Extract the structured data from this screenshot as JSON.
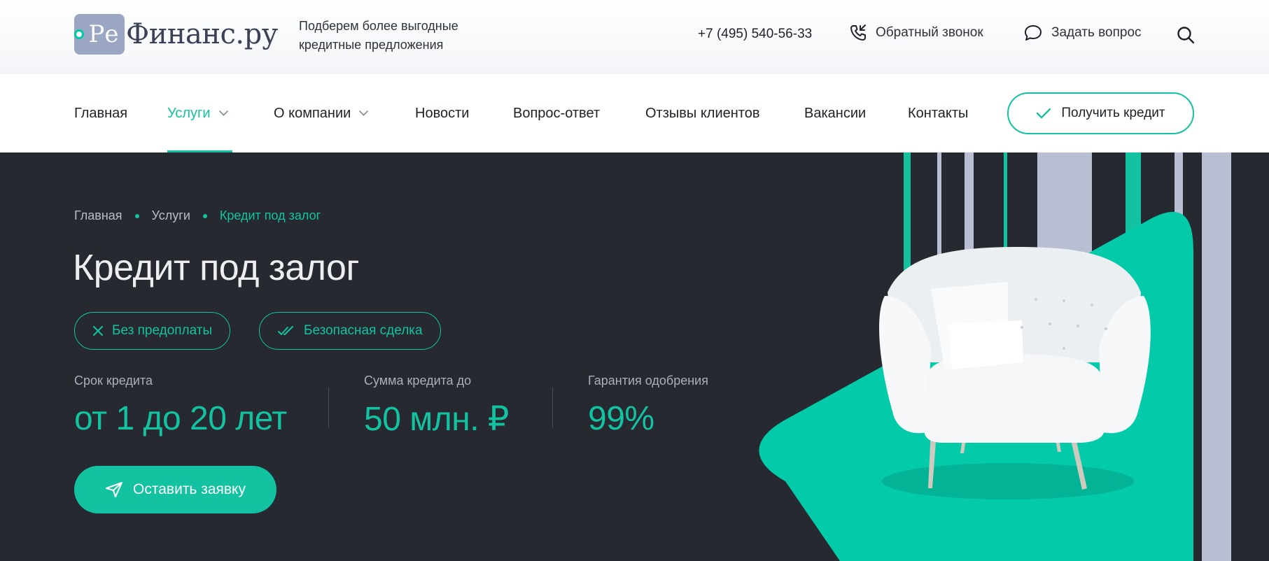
{
  "header": {
    "logo_re": "Ре",
    "logo_text": "Финанс.ру",
    "tagline_line1": "Подберем более выгодные",
    "tagline_line2": "кредитные предложения",
    "phone": "+7 (495) 540-56-33",
    "callback_label": "Обратный звонок",
    "ask_label": "Задать вопрос"
  },
  "nav": {
    "items": [
      {
        "label": "Главная"
      },
      {
        "label": "Услуги"
      },
      {
        "label": "О компании"
      },
      {
        "label": "Новости"
      },
      {
        "label": "Вопрос-ответ"
      },
      {
        "label": "Отзывы клиентов"
      },
      {
        "label": "Вакансии"
      },
      {
        "label": "Контакты"
      }
    ],
    "active": "Услуги",
    "cta_label": "Получить кредит"
  },
  "hero": {
    "breadcrumbs": [
      "Главная",
      "Услуги",
      "Кредит под залог"
    ],
    "title": "Кредит под залог",
    "chips": [
      "Без предоплаты",
      "Безопасная сделка"
    ],
    "stats": [
      {
        "label": "Срок кредита",
        "value": "от 1 до 20 лет"
      },
      {
        "label": "Сумма кредита до",
        "value": "50 млн. ₽"
      },
      {
        "label": "Гарантия одобрения",
        "value": "99%"
      }
    ],
    "apply_label": "Оставить заявку"
  },
  "colors": {
    "accent": "#13c2a0",
    "hero_bg": "#262930",
    "stripe": "#b9bfd2",
    "logo_badge": "#9aa6c2"
  },
  "icons": [
    "logo-dot-icon",
    "phone-callback-icon",
    "chat-bubble-icon",
    "search-icon",
    "chevron-down-icon",
    "check-icon",
    "close-icon",
    "double-check-icon",
    "send-icon"
  ]
}
